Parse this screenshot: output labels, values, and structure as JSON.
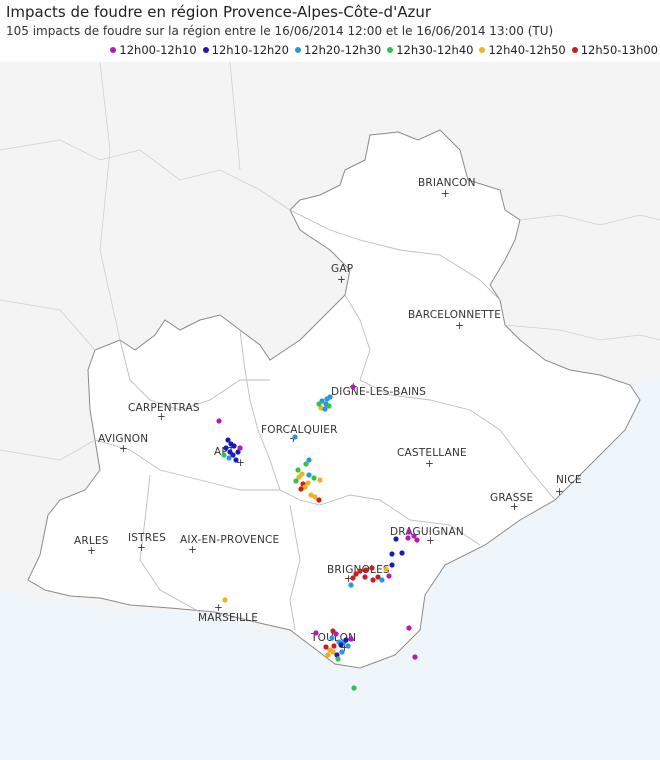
{
  "header": {
    "title": "Impacts de foudre en région Provence-Alpes-Côte-d'Azur",
    "subtitle": "105 impacts de foudre sur la région entre le 16/06/2014 12:00 et le 16/06/2014 13:00 (TU)"
  },
  "legend": [
    {
      "label": "12h00-12h10",
      "color": "#b21cb4"
    },
    {
      "label": "12h10-12h20",
      "color": "#1c1cb4"
    },
    {
      "label": "12h20-12h30",
      "color": "#2a96dc"
    },
    {
      "label": "12h30-12h40",
      "color": "#2ec44a"
    },
    {
      "label": "12h40-12h50",
      "color": "#f0b020"
    },
    {
      "label": "12h50-13h00",
      "color": "#c81e1e"
    }
  ],
  "cities": [
    {
      "name": "BRIANCON"
    },
    {
      "name": "GAP"
    },
    {
      "name": "BARCELONNETTE"
    },
    {
      "name": "DIGNE-LES-BAINS"
    },
    {
      "name": "CARPENTRAS"
    },
    {
      "name": "FORCALQUIER"
    },
    {
      "name": "AVIGNON"
    },
    {
      "name": "APT"
    },
    {
      "name": "CASTELLANE"
    },
    {
      "name": "NICE"
    },
    {
      "name": "GRASSE"
    },
    {
      "name": "DRAGUIGNAN"
    },
    {
      "name": "ARLES"
    },
    {
      "name": "ISTRES"
    },
    {
      "name": "AIX-EN-PROVENCE"
    },
    {
      "name": "BRIGNOLES"
    },
    {
      "name": "MARSEILLE"
    },
    {
      "name": "TOULON"
    }
  ],
  "colors": {
    "sea": "#eef5fb",
    "land_outside": "#f4f4f4",
    "region": "#ffffff",
    "border": "#7a7a7a"
  }
}
